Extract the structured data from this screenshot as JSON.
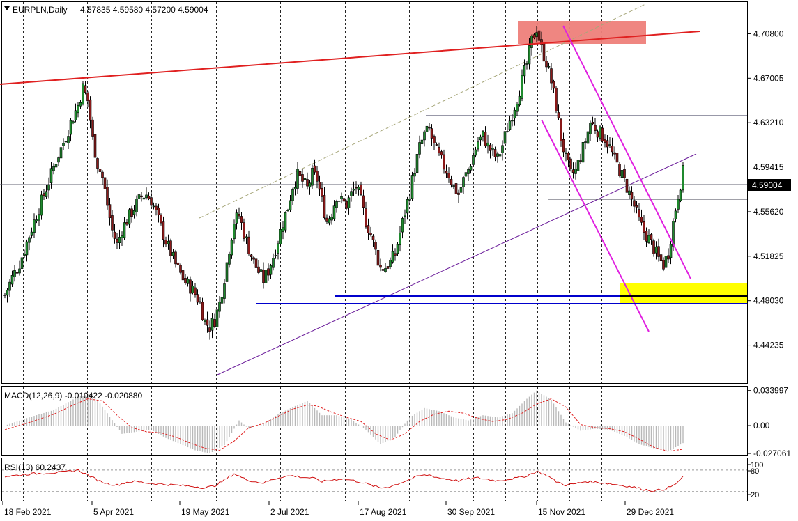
{
  "header": {
    "symbol": "EURPLN,Daily",
    "ohlc": "4.57835 4.59580 4.57200 4.59004"
  },
  "macd": {
    "label": "MACD(12,26,9) -0.010422 -0.020880"
  },
  "rsi": {
    "label": "RSI(13) 60.2437"
  },
  "chart_data": [
    {
      "type": "candlestick",
      "title": "EURPLN,Daily",
      "ylim": [
        4.41,
        4.735
      ],
      "y_ticks": [
        "4.70800",
        "4.67005",
        "4.63210",
        "4.55620",
        "4.51825",
        "4.48030",
        "4.44235"
      ],
      "y_ticks_values": [
        4.708,
        4.67005,
        4.6321,
        4.5562,
        4.51825,
        4.4803,
        4.44235
      ],
      "partially_hidden_tick": "4.59415",
      "current_price": "4.59004",
      "x_labels": [
        "18 Feb 2021",
        "5 Apr 2021",
        "19 May 2021",
        "2 Jul 2021",
        "17 Aug 2021",
        "30 Sep 2021",
        "15 Nov 2021",
        "29 Dec 2021"
      ],
      "close_path": [
        [
          0,
          4.485
        ],
        [
          3,
          4.5
        ],
        [
          6,
          4.512
        ],
        [
          9,
          4.53
        ],
        [
          12,
          4.548
        ],
        [
          15,
          4.565
        ],
        [
          18,
          4.582
        ],
        [
          21,
          4.6
        ],
        [
          24,
          4.615
        ],
        [
          27,
          4.632
        ],
        [
          30,
          4.647
        ],
        [
          32,
          4.662
        ],
        [
          34,
          4.651
        ],
        [
          36,
          4.618
        ],
        [
          38,
          4.597
        ],
        [
          40,
          4.585
        ],
        [
          42,
          4.562
        ],
        [
          44,
          4.54
        ],
        [
          46,
          4.528
        ],
        [
          48,
          4.541
        ],
        [
          50,
          4.549
        ],
        [
          52,
          4.556
        ],
        [
          54,
          4.563
        ],
        [
          56,
          4.569
        ],
        [
          58,
          4.571
        ],
        [
          60,
          4.566
        ],
        [
          62,
          4.555
        ],
        [
          64,
          4.543
        ],
        [
          66,
          4.531
        ],
        [
          68,
          4.521
        ],
        [
          70,
          4.511
        ],
        [
          72,
          4.503
        ],
        [
          74,
          4.496
        ],
        [
          76,
          4.492
        ],
        [
          78,
          4.486
        ],
        [
          80,
          4.478
        ],
        [
          82,
          4.462
        ],
        [
          84,
          4.458
        ],
        [
          86,
          4.464
        ],
        [
          88,
          4.478
        ],
        [
          90,
          4.5
        ],
        [
          92,
          4.525
        ],
        [
          94,
          4.548
        ],
        [
          96,
          4.553
        ],
        [
          98,
          4.538
        ],
        [
          100,
          4.525
        ],
        [
          102,
          4.513
        ],
        [
          104,
          4.505
        ],
        [
          106,
          4.498
        ],
        [
          108,
          4.506
        ],
        [
          110,
          4.518
        ],
        [
          112,
          4.532
        ],
        [
          114,
          4.547
        ],
        [
          116,
          4.56
        ],
        [
          118,
          4.578
        ],
        [
          120,
          4.587
        ],
        [
          122,
          4.582
        ],
        [
          124,
          4.576
        ],
        [
          126,
          4.588
        ],
        [
          128,
          4.584
        ],
        [
          130,
          4.565
        ],
        [
          132,
          4.548
        ],
        [
          134,
          4.556
        ],
        [
          136,
          4.57
        ],
        [
          138,
          4.565
        ],
        [
          140,
          4.562
        ],
        [
          142,
          4.571
        ],
        [
          144,
          4.578
        ],
        [
          146,
          4.565
        ],
        [
          148,
          4.548
        ],
        [
          150,
          4.537
        ],
        [
          152,
          4.522
        ],
        [
          154,
          4.508
        ],
        [
          156,
          4.509
        ],
        [
          158,
          4.513
        ],
        [
          160,
          4.52
        ],
        [
          162,
          4.538
        ],
        [
          164,
          4.556
        ],
        [
          166,
          4.573
        ],
        [
          168,
          4.593
        ],
        [
          170,
          4.611
        ],
        [
          172,
          4.622
        ],
        [
          174,
          4.626
        ],
        [
          176,
          4.612
        ],
        [
          178,
          4.603
        ],
        [
          180,
          4.595
        ],
        [
          182,
          4.588
        ],
        [
          184,
          4.577
        ],
        [
          186,
          4.571
        ],
        [
          188,
          4.583
        ],
        [
          190,
          4.592
        ],
        [
          192,
          4.604
        ],
        [
          194,
          4.616
        ],
        [
          196,
          4.621
        ],
        [
          198,
          4.612
        ],
        [
          200,
          4.606
        ],
        [
          202,
          4.601
        ],
        [
          204,
          4.613
        ],
        [
          206,
          4.628
        ],
        [
          208,
          4.64
        ],
        [
          210,
          4.653
        ],
        [
          212,
          4.668
        ],
        [
          214,
          4.682
        ],
        [
          216,
          4.702
        ],
        [
          218,
          4.713
        ],
        [
          220,
          4.695
        ],
        [
          222,
          4.684
        ],
        [
          224,
          4.667
        ],
        [
          226,
          4.646
        ],
        [
          228,
          4.619
        ],
        [
          230,
          4.601
        ],
        [
          232,
          4.588
        ],
        [
          234,
          4.591
        ],
        [
          236,
          4.604
        ],
        [
          238,
          4.617
        ],
        [
          240,
          4.632
        ],
        [
          242,
          4.628
        ],
        [
          244,
          4.623
        ],
        [
          246,
          4.619
        ],
        [
          248,
          4.611
        ],
        [
          250,
          4.6
        ],
        [
          252,
          4.592
        ],
        [
          254,
          4.582
        ],
        [
          256,
          4.572
        ],
        [
          258,
          4.561
        ],
        [
          260,
          4.548
        ],
        [
          262,
          4.539
        ],
        [
          264,
          4.533
        ],
        [
          266,
          4.525
        ],
        [
          268,
          4.516
        ],
        [
          270,
          4.511
        ],
        [
          272,
          4.521
        ],
        [
          274,
          4.547
        ],
        [
          276,
          4.571
        ],
        [
          278,
          4.59
        ]
      ]
    },
    {
      "type": "histogram+line",
      "title": "MACD(12,26,9)",
      "ylim": [
        -0.032,
        0.04
      ],
      "y_ticks": [
        "0.033997",
        "0.00",
        "-0.027061"
      ],
      "y_ticks_values": [
        0.033997,
        0.0,
        -0.027061
      ],
      "macd_histogram": [
        [
          0,
          0.0
        ],
        [
          10,
          0.008
        ],
        [
          20,
          0.015
        ],
        [
          30,
          0.028
        ],
        [
          36,
          0.031
        ],
        [
          42,
          0.012
        ],
        [
          48,
          -0.008
        ],
        [
          54,
          -0.006
        ],
        [
          60,
          -0.004
        ],
        [
          66,
          -0.012
        ],
        [
          72,
          -0.018
        ],
        [
          78,
          -0.024
        ],
        [
          84,
          -0.027
        ],
        [
          90,
          -0.019
        ],
        [
          96,
          0.005
        ],
        [
          100,
          -0.003
        ],
        [
          106,
          0.002
        ],
        [
          112,
          0.011
        ],
        [
          118,
          0.018
        ],
        [
          124,
          0.024
        ],
        [
          130,
          0.01
        ],
        [
          136,
          0.01
        ],
        [
          142,
          0.006
        ],
        [
          148,
          -0.004
        ],
        [
          154,
          -0.018
        ],
        [
          160,
          -0.011
        ],
        [
          166,
          0.008
        ],
        [
          172,
          0.017
        ],
        [
          178,
          0.014
        ],
        [
          184,
          0.008
        ],
        [
          190,
          0.005
        ],
        [
          196,
          0.01
        ],
        [
          202,
          0.008
        ],
        [
          208,
          0.012
        ],
        [
          214,
          0.026
        ],
        [
          218,
          0.034
        ],
        [
          224,
          0.025
        ],
        [
          230,
          0.003
        ],
        [
          236,
          -0.005
        ],
        [
          242,
          -0.003
        ],
        [
          248,
          -0.004
        ],
        [
          254,
          -0.01
        ],
        [
          260,
          -0.018
        ],
        [
          266,
          -0.022
        ],
        [
          272,
          -0.025
        ],
        [
          278,
          -0.017
        ]
      ],
      "signal_line": [
        [
          0,
          -0.004
        ],
        [
          10,
          0.003
        ],
        [
          20,
          0.011
        ],
        [
          28,
          0.02
        ],
        [
          34,
          0.026
        ],
        [
          40,
          0.024
        ],
        [
          46,
          0.01
        ],
        [
          52,
          -0.002
        ],
        [
          58,
          -0.006
        ],
        [
          64,
          -0.007
        ],
        [
          70,
          -0.011
        ],
        [
          76,
          -0.017
        ],
        [
          82,
          -0.022
        ],
        [
          88,
          -0.024
        ],
        [
          94,
          -0.015
        ],
        [
          100,
          -0.002
        ],
        [
          106,
          0.002
        ],
        [
          112,
          0.009
        ],
        [
          118,
          0.016
        ],
        [
          124,
          0.02
        ],
        [
          128,
          0.019
        ],
        [
          134,
          0.013
        ],
        [
          140,
          0.008
        ],
        [
          146,
          0.004
        ],
        [
          152,
          -0.008
        ],
        [
          158,
          -0.014
        ],
        [
          164,
          -0.008
        ],
        [
          170,
          0.004
        ],
        [
          176,
          0.011
        ],
        [
          182,
          0.014
        ],
        [
          188,
          0.012
        ],
        [
          194,
          0.007
        ],
        [
          200,
          0.004
        ],
        [
          206,
          0.006
        ],
        [
          212,
          0.012
        ],
        [
          218,
          0.021
        ],
        [
          224,
          0.026
        ],
        [
          230,
          0.018
        ],
        [
          236,
          0.001
        ],
        [
          242,
          -0.002
        ],
        [
          248,
          -0.003
        ],
        [
          254,
          -0.006
        ],
        [
          260,
          -0.013
        ],
        [
          266,
          -0.021
        ],
        [
          272,
          -0.025
        ],
        [
          278,
          -0.023
        ]
      ]
    },
    {
      "type": "line",
      "title": "RSI(13)",
      "ylim": [
        0,
        100
      ],
      "y_ticks": [
        "100",
        "80",
        "20"
      ],
      "y_ticks_values": [
        100,
        80,
        20
      ],
      "values": [
        [
          0,
          62
        ],
        [
          6,
          66
        ],
        [
          12,
          70
        ],
        [
          18,
          72
        ],
        [
          24,
          74
        ],
        [
          30,
          80
        ],
        [
          34,
          66
        ],
        [
          38,
          52
        ],
        [
          42,
          42
        ],
        [
          46,
          38
        ],
        [
          50,
          46
        ],
        [
          54,
          48
        ],
        [
          58,
          44
        ],
        [
          62,
          42
        ],
        [
          66,
          40
        ],
        [
          70,
          38
        ],
        [
          74,
          36
        ],
        [
          78,
          34
        ],
        [
          82,
          30
        ],
        [
          86,
          36
        ],
        [
          90,
          52
        ],
        [
          94,
          70
        ],
        [
          98,
          56
        ],
        [
          102,
          48
        ],
        [
          106,
          44
        ],
        [
          110,
          54
        ],
        [
          114,
          62
        ],
        [
          118,
          64
        ],
        [
          122,
          60
        ],
        [
          126,
          58
        ],
        [
          130,
          48
        ],
        [
          134,
          52
        ],
        [
          138,
          56
        ],
        [
          142,
          52
        ],
        [
          146,
          46
        ],
        [
          150,
          38
        ],
        [
          154,
          30
        ],
        [
          158,
          34
        ],
        [
          162,
          44
        ],
        [
          166,
          54
        ],
        [
          170,
          64
        ],
        [
          174,
          66
        ],
        [
          178,
          58
        ],
        [
          182,
          54
        ],
        [
          186,
          50
        ],
        [
          190,
          56
        ],
        [
          194,
          58
        ],
        [
          198,
          54
        ],
        [
          202,
          50
        ],
        [
          206,
          54
        ],
        [
          210,
          58
        ],
        [
          214,
          64
        ],
        [
          218,
          76
        ],
        [
          222,
          66
        ],
        [
          226,
          48
        ],
        [
          230,
          38
        ],
        [
          234,
          42
        ],
        [
          238,
          48
        ],
        [
          242,
          46
        ],
        [
          246,
          44
        ],
        [
          250,
          40
        ],
        [
          254,
          36
        ],
        [
          258,
          32
        ],
        [
          262,
          26
        ],
        [
          266,
          22
        ],
        [
          270,
          26
        ],
        [
          274,
          36
        ],
        [
          278,
          60
        ]
      ]
    }
  ]
}
